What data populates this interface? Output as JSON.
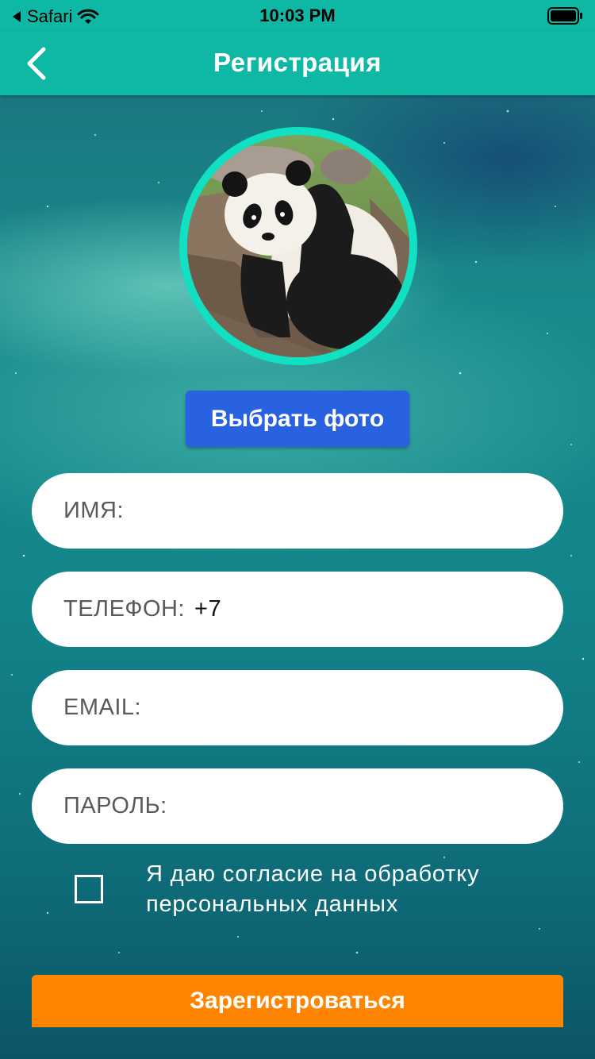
{
  "status_bar": {
    "back_app": "Safari",
    "time": "10:03 PM"
  },
  "nav": {
    "title": "Регистрация",
    "back_icon": "chevron-left-icon"
  },
  "avatar": {
    "description_icon": "avatar-photo"
  },
  "photo_button": {
    "label": "Выбрать фото"
  },
  "form": {
    "name": {
      "label": "ИМЯ:",
      "value": ""
    },
    "phone": {
      "label": "ТЕЛЕФОН:",
      "value": "+7"
    },
    "email": {
      "label": "EMAIL:",
      "value": ""
    },
    "password": {
      "label": "ПАРОЛЬ:",
      "value": ""
    }
  },
  "consent": {
    "text": "Я даю согласие на обработку персональных данных",
    "checked": false
  },
  "register_button": {
    "label": "Зарегистроваться"
  },
  "colors": {
    "header": "#0fb8a4",
    "avatar_ring": "#12e0c2",
    "photo_button": "#2862e0",
    "register_button": "#ff8500"
  }
}
